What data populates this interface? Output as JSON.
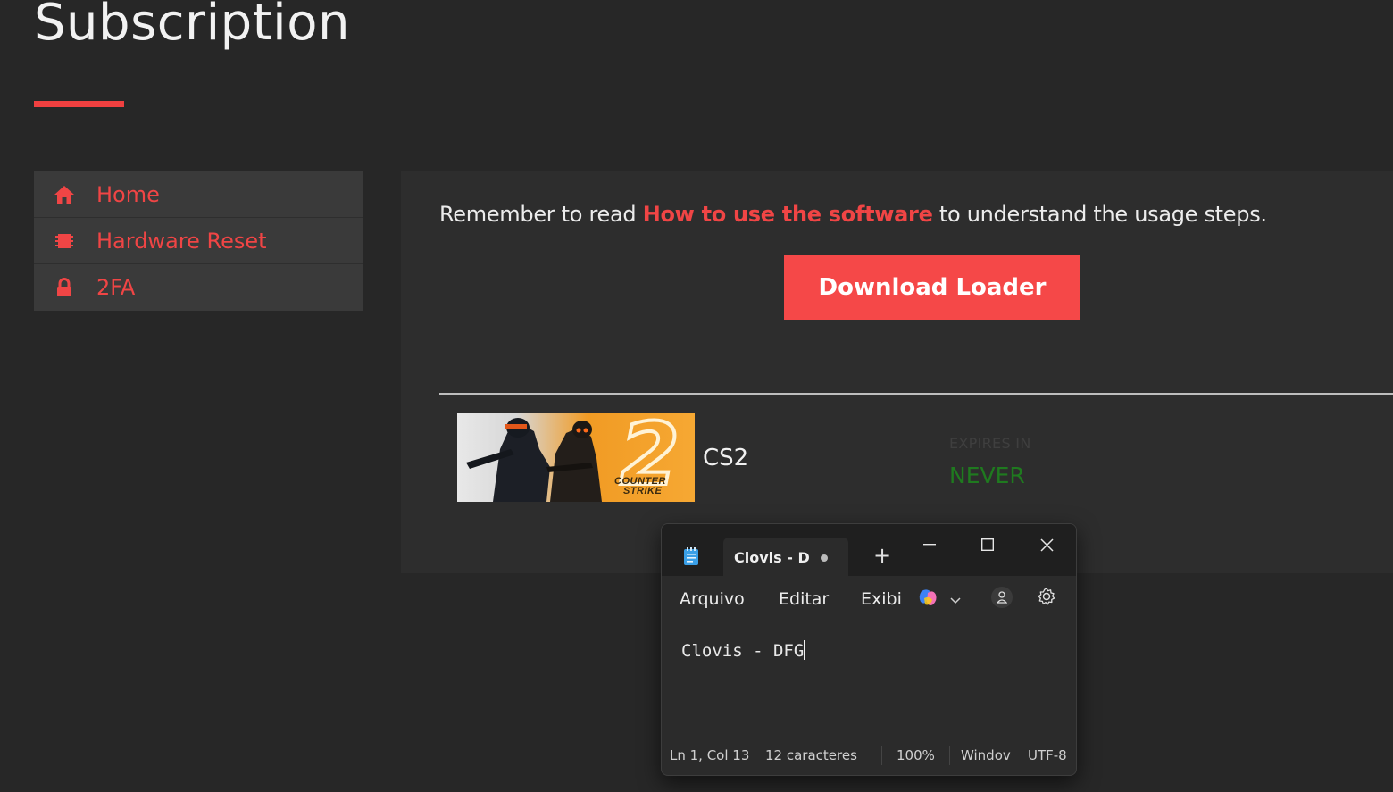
{
  "page": {
    "title": "Subscription"
  },
  "sidebar": {
    "items": [
      {
        "label": "Home",
        "icon": "home-icon"
      },
      {
        "label": "Hardware Reset",
        "icon": "chip-icon"
      },
      {
        "label": "2FA",
        "icon": "lock-icon"
      }
    ]
  },
  "main": {
    "remember_prefix": "Remember to read ",
    "remember_link": "How to use the software",
    "remember_suffix": " to understand the usage steps.",
    "download_label": "Download Loader",
    "subscription": {
      "game": "CS2",
      "thumb_text_1": "COUNTER",
      "thumb_text_2": "STRIKE",
      "thumb_number": "2",
      "expires_label": "EXPIRES IN",
      "expires_value": "NEVER"
    }
  },
  "notepad": {
    "tab_title": "Clovis - D",
    "menu": [
      "Arquivo",
      "Editar",
      "Exibi"
    ],
    "content": "Clovis - DFG",
    "status": {
      "position": "Ln 1, Col 13",
      "chars": "12 caracteres",
      "zoom": "100%",
      "eol": "Windov",
      "encoding": "UTF-8"
    }
  },
  "colors": {
    "accent": "#f04545",
    "background": "#272727",
    "panel": "#2d2d2d",
    "never": "#1f7a1f"
  }
}
